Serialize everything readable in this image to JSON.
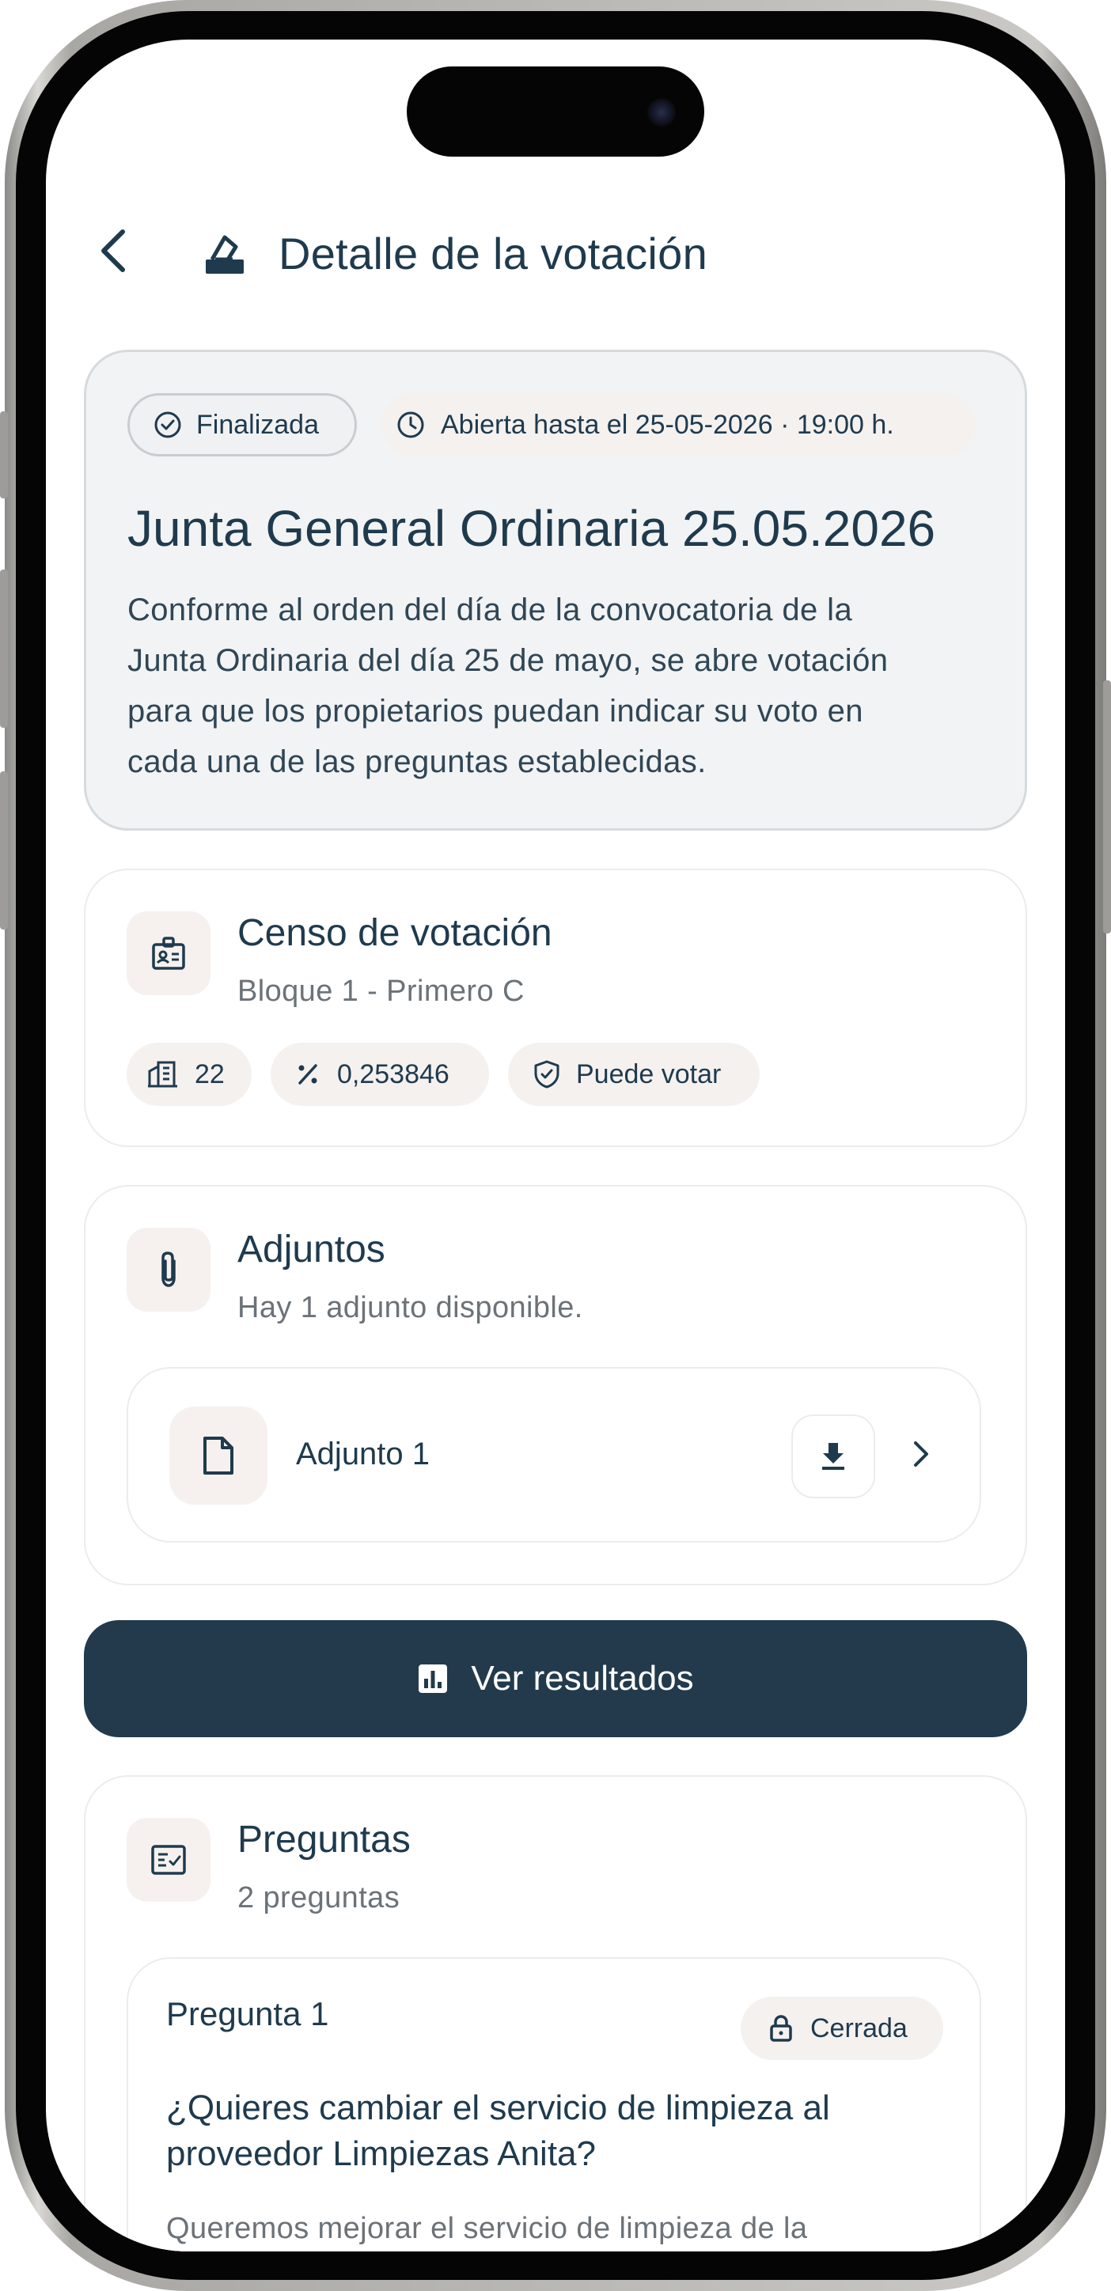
{
  "header": {
    "title": "Detalle de la votación"
  },
  "summary": {
    "status_label": "Finalizada",
    "deadline_label": "Abierta hasta el 25-05-2026 · 19:00 h.",
    "title": "Junta General Ordinaria 25.05.2026",
    "description_lines": [
      "Conforme al orden del día de la convocatoria de la",
      "Junta Ordinaria del día 25 de mayo, se abre votación",
      "para que los propietarios puedan indicar su voto en",
      "cada una de las preguntas establecidas."
    ]
  },
  "census": {
    "title": "Censo de votación",
    "subtitle": "Bloque 1 - Primero C",
    "unit_count": "22",
    "coefficient": "0,253846",
    "vote_status": "Puede votar"
  },
  "attachments": {
    "title": "Adjuntos",
    "subtitle": "Hay 1 adjunto disponible.",
    "items": [
      {
        "name": "Adjunto 1"
      }
    ]
  },
  "results_button": {
    "label": "Ver resultados"
  },
  "questions": {
    "title": "Preguntas",
    "subtitle": "2 preguntas",
    "items": [
      {
        "label": "Pregunta 1",
        "status": "Cerrada",
        "title_lines": [
          "¿Quieres cambiar el servicio de limpieza al",
          "proveedor Limpiezas Anita?"
        ],
        "description_line": "Queremos mejorar el servicio de limpieza de la"
      }
    ]
  },
  "colors": {
    "primary": "#223a4b",
    "text": "#1f3a4d",
    "muted": "#6b7278",
    "chip_bg": "#f5f1ef"
  },
  "icons": {
    "back": "chevron-left-icon",
    "header": "ballot-box-icon",
    "status": "check-circle-icon",
    "deadline": "clock-icon",
    "census": "id-card-icon",
    "units": "building-icon",
    "percent": "percent-icon",
    "shield": "shield-check-icon",
    "attachments": "paperclip-icon",
    "file": "file-icon",
    "download": "download-icon",
    "chevron": "chevron-right-icon",
    "results": "bar-chart-icon",
    "questions": "checklist-icon",
    "lock": "lock-icon"
  }
}
